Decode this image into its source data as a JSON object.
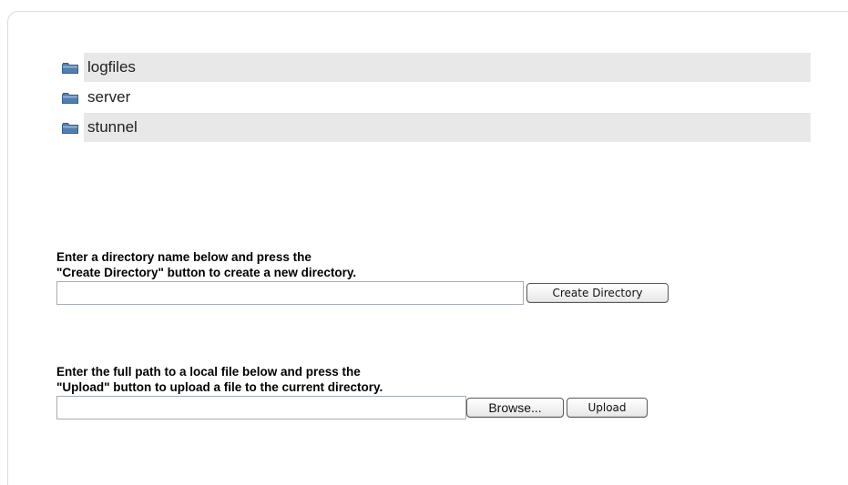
{
  "directories": [
    {
      "name": "logfiles",
      "shaded": true
    },
    {
      "name": "server",
      "shaded": false
    },
    {
      "name": "stunnel",
      "shaded": true
    }
  ],
  "create_dir": {
    "prompt_line1": "Enter a directory name below and press the",
    "prompt_line2": "\"Create Directory\" button to create a new directory.",
    "input_value": "",
    "button_label": "Create Directory"
  },
  "upload": {
    "prompt_line1": "Enter the full path to a local file below and press the",
    "prompt_line2": "\"Upload\" button to upload a file to the current directory.",
    "input_value": "",
    "browse_label": "Browse...",
    "upload_label": "Upload"
  },
  "colors": {
    "folder": "#4f7fb0",
    "row_shade": "#e8e8e8"
  },
  "icons": {
    "folder": "folder-icon"
  }
}
